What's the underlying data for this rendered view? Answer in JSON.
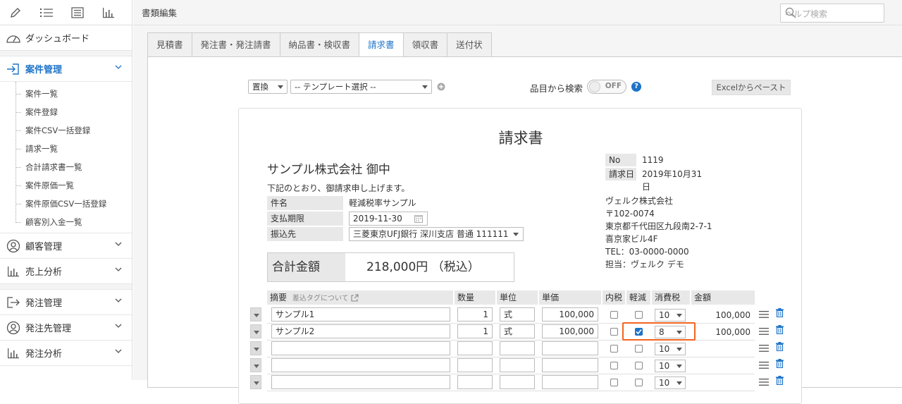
{
  "sidebar": {
    "top_icons": [
      "pencil-icon",
      "list-icon",
      "list-box-icon",
      "bar-chart-icon"
    ],
    "dashboard": "ダッシュボード",
    "case_mgmt": "案件管理",
    "case_items": [
      "案件一覧",
      "案件登録",
      "案件CSV一括登録",
      "請求一覧",
      "合計請求書一覧",
      "案件原価一覧",
      "案件原価CSV一括登録",
      "顧客別入金一覧"
    ],
    "customer_mgmt": "顧客管理",
    "sales_analysis": "売上分析",
    "order_mgmt": "発注管理",
    "supplier_mgmt": "発注先管理",
    "order_analysis": "発注分析"
  },
  "header": {
    "title": "書類編集",
    "help_placeholder": "ヘルプ検索"
  },
  "tabs": [
    "見積書",
    "発注書・発注請書",
    "納品書・検収書",
    "請求書",
    "領収書",
    "送付状"
  ],
  "toolbar": {
    "replace": "置換",
    "template": "-- テンプレート選択 --",
    "search_label": "品目から検索",
    "toggle": "OFF",
    "excel_paste": "Excelからペースト"
  },
  "document": {
    "title": "請求書",
    "client": "サンプル株式会社 御中",
    "intro": "下記のとおり、御請求申し上げます。",
    "subject_label": "件名",
    "subject_value": "軽減税率サンプル",
    "due_label": "支払期限",
    "due_value": "2019-11-30",
    "bank_label": "振込先",
    "bank_value": "三菱東京UFJ銀行 深川支店 普通 111111",
    "total_label": "合計金額",
    "total_value": "218,000円 （税込）",
    "no_label": "No",
    "no_value": "1119",
    "date_label": "請求日",
    "date_value": "2019年10月31日",
    "company": "ヴェルク株式会社",
    "zip": "〒102-0074",
    "addr1": "東京都千代田区九段南2-7-1",
    "addr2": "喜京家ビル4F",
    "tel": "TEL：03-0000-0000",
    "person": "担当：ヴェルク デモ"
  },
  "table": {
    "headers": {
      "desc": "摘要",
      "tag_link": "差込タグについて",
      "qty": "数量",
      "unit": "単位",
      "price": "単価",
      "tax_inc": "内税",
      "reduced": "軽減",
      "tax": "消費税",
      "amount": "金額"
    },
    "rows": [
      {
        "desc": "サンプル1",
        "qty": "1",
        "unit": "式",
        "price": "100,000",
        "tax_inc": false,
        "reduced": false,
        "tax": "10",
        "amount": "100,000"
      },
      {
        "desc": "サンプル2",
        "qty": "1",
        "unit": "式",
        "price": "100,000",
        "tax_inc": false,
        "reduced": true,
        "tax": "8",
        "amount": "100,000"
      },
      {
        "desc": "",
        "qty": "",
        "unit": "",
        "price": "",
        "tax_inc": false,
        "reduced": false,
        "tax": "10",
        "amount": ""
      },
      {
        "desc": "",
        "qty": "",
        "unit": "",
        "price": "",
        "tax_inc": false,
        "reduced": false,
        "tax": "10",
        "amount": ""
      },
      {
        "desc": "",
        "qty": "",
        "unit": "",
        "price": "",
        "tax_inc": false,
        "reduced": false,
        "tax": "10",
        "amount": ""
      }
    ]
  },
  "colors": {
    "accent": "#1d73c8",
    "highlight": "#f26422"
  }
}
